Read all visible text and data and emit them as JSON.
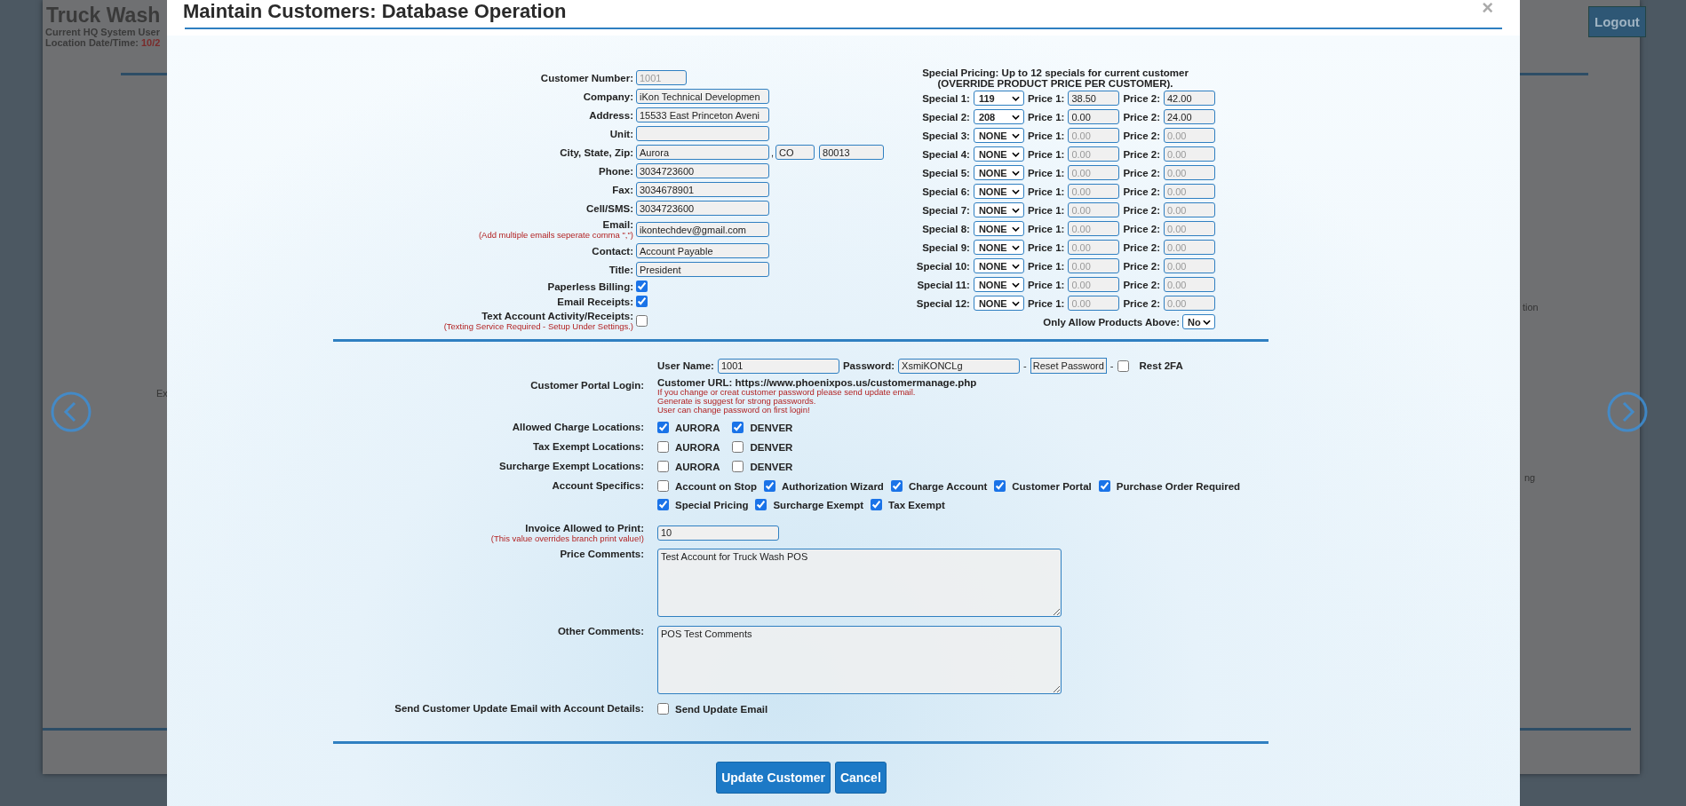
{
  "page": {
    "title": "Truck Wash",
    "user_line": "Current HQ System User",
    "datetime_label": "Location Date/Time:",
    "datetime_value": "10/2",
    "logout": "Logout",
    "fragment_left": "Ex",
    "fragment_right_top": "tion",
    "fragment_right_bottom": "ng"
  },
  "modal": {
    "title": "Maintain Customers: Database Operation",
    "close": "×"
  },
  "customer_fields": [
    {
      "kind": "number",
      "label": "Customer Number:",
      "value": "1001",
      "disabled": true
    },
    {
      "kind": "text",
      "label": "Company:",
      "value": "iKon Technical Developmen"
    },
    {
      "kind": "text",
      "label": "Address:",
      "value": "15533 East Princeton Aveni"
    },
    {
      "kind": "text",
      "label": "Unit:"
    },
    {
      "kind": "city",
      "label": "City, State, Zip:",
      "value": "Aurora",
      "separator": ",",
      "state": "CO",
      "zip": "80013"
    },
    {
      "kind": "text",
      "label": "Phone:",
      "value": "3034723600"
    },
    {
      "kind": "text",
      "label": "Fax:",
      "value": "3034678901"
    },
    {
      "kind": "text",
      "label": "Cell/SMS:",
      "value": "3034723600"
    },
    {
      "kind": "text",
      "label": "Email:",
      "note": "(Add multiple emails seperate comma \",\")",
      "value": "ikontechdev@gmail.com"
    },
    {
      "kind": "text",
      "label": "Contact:",
      "value": "Account Payable"
    },
    {
      "kind": "text",
      "label": "Title:",
      "value": "President"
    },
    {
      "kind": "checkbox",
      "label": "Paperless Billing:",
      "checked": true
    },
    {
      "kind": "checkbox",
      "label": "Email Receipts:",
      "checked": true
    },
    {
      "kind": "checkbox",
      "label": "Text Account Activity/Receipts:",
      "note": "(Texting Service Required - Setup Under Settings.)",
      "checked": false
    }
  ],
  "special_pricing": {
    "heading": "Special Pricing: Up to 12 specials for current customer",
    "subheading": "(OVERRIDE PRODUCT PRICE PER CUSTOMER).",
    "rows": [
      {
        "label": "Special 1:",
        "product": "119",
        "price1_label": "Price 1:",
        "price1": "38.50",
        "price2_label": "Price 2:",
        "price2": "42.00",
        "disabled": false
      },
      {
        "label": "Special 2:",
        "product": "208",
        "price1_label": "Price 1:",
        "price1": "0.00",
        "price2_label": "Price 2:",
        "price2": "24.00",
        "disabled": false
      },
      {
        "label": "Special 3:",
        "product": "NONE",
        "price1_label": "Price 1:",
        "price1": "0.00",
        "price2_label": "Price 2:",
        "price2": "0.00",
        "disabled": true
      },
      {
        "label": "Special 4:",
        "product": "NONE",
        "price1_label": "Price 1:",
        "price1": "0.00",
        "price2_label": "Price 2:",
        "price2": "0.00",
        "disabled": true
      },
      {
        "label": "Special 5:",
        "product": "NONE",
        "price1_label": "Price 1:",
        "price1": "0.00",
        "price2_label": "Price 2:",
        "price2": "0.00",
        "disabled": true
      },
      {
        "label": "Special 6:",
        "product": "NONE",
        "price1_label": "Price 1:",
        "price1": "0.00",
        "price2_label": "Price 2:",
        "price2": "0.00",
        "disabled": true
      },
      {
        "label": "Special 7:",
        "product": "NONE",
        "price1_label": "Price 1:",
        "price1": "0.00",
        "price2_label": "Price 2:",
        "price2": "0.00",
        "disabled": true
      },
      {
        "label": "Special 8:",
        "product": "NONE",
        "price1_label": "Price 1:",
        "price1": "0.00",
        "price2_label": "Price 2:",
        "price2": "0.00",
        "disabled": true
      },
      {
        "label": "Special 9:",
        "product": "NONE",
        "price1_label": "Price 1:",
        "price1": "0.00",
        "price2_label": "Price 2:",
        "price2": "0.00",
        "disabled": true
      },
      {
        "label": "Special 10:",
        "product": "NONE",
        "price1_label": "Price 1:",
        "price1": "0.00",
        "price2_label": "Price 2:",
        "price2": "0.00",
        "disabled": true
      },
      {
        "label": "Special 11:",
        "product": "NONE",
        "price1_label": "Price 1:",
        "price1": "0.00",
        "price2_label": "Price 2:",
        "price2": "0.00",
        "disabled": true
      },
      {
        "label": "Special 12:",
        "product": "NONE",
        "price1_label": "Price 1:",
        "price1": "0.00",
        "price2_label": "Price 2:",
        "price2": "0.00",
        "disabled": true
      }
    ],
    "only_allow": {
      "label": "Only Allow Products Above:",
      "value": "No"
    }
  },
  "portal": {
    "label": "Customer Portal Login:",
    "username_label": "User Name:",
    "username": "1001",
    "password_label": "Password:",
    "password": "XsmiKONCLg",
    "dash_1": "-",
    "reset": "Reset Password",
    "dash_2": "-",
    "rest_2fa": {
      "label": "Rest 2FA",
      "checked": false
    },
    "url_label": "Customer URL:",
    "url": "https://www.phoenixpos.us/customermanage.php",
    "notes": [
      "If you change or creat customer password please send update email.",
      "Generate is suggest for strong passwords.",
      "User can change password on first login!"
    ]
  },
  "locations": [
    {
      "label": "Allowed Charge Locations:",
      "options": [
        {
          "label": "AURORA",
          "checked": true
        },
        {
          "label": "DENVER",
          "checked": true
        }
      ]
    },
    {
      "label": "Tax Exempt Locations:",
      "options": [
        {
          "label": "AURORA",
          "checked": false
        },
        {
          "label": "DENVER",
          "checked": false
        }
      ]
    },
    {
      "label": "Surcharge Exempt Locations:",
      "options": [
        {
          "label": "AURORA",
          "checked": false
        },
        {
          "label": "DENVER",
          "checked": false
        }
      ]
    }
  ],
  "account_specifics": {
    "label": "Account Specifics:",
    "lines": [
      [
        {
          "label": "Account on Stop",
          "checked": false
        },
        {
          "label": "Authorization Wizard",
          "checked": true
        },
        {
          "label": "Charge Account",
          "checked": true
        },
        {
          "label": "Customer Portal",
          "checked": true
        },
        {
          "label": "Purchase Order Required",
          "checked": true
        }
      ],
      [
        {
          "label": "Special Pricing",
          "checked": true
        },
        {
          "label": "Surcharge Exempt",
          "checked": true
        },
        {
          "label": "Tax Exempt",
          "checked": true
        }
      ]
    ]
  },
  "invoice": {
    "label": "Invoice Allowed to Print:",
    "note": "(This value overrides branch print value!)",
    "value": "10"
  },
  "comments": [
    {
      "label": "Price Comments:",
      "value": "Test Account for Truck Wash POS"
    },
    {
      "label": "Other Comments:",
      "value": "POS Test Comments"
    }
  ],
  "send_email": {
    "label": "Send Customer Update Email with Account Details:",
    "option": {
      "label": "Send Update Email",
      "checked": false
    }
  },
  "buttons": [
    {
      "label": "Update Customer"
    },
    {
      "label": "Cancel"
    }
  ]
}
